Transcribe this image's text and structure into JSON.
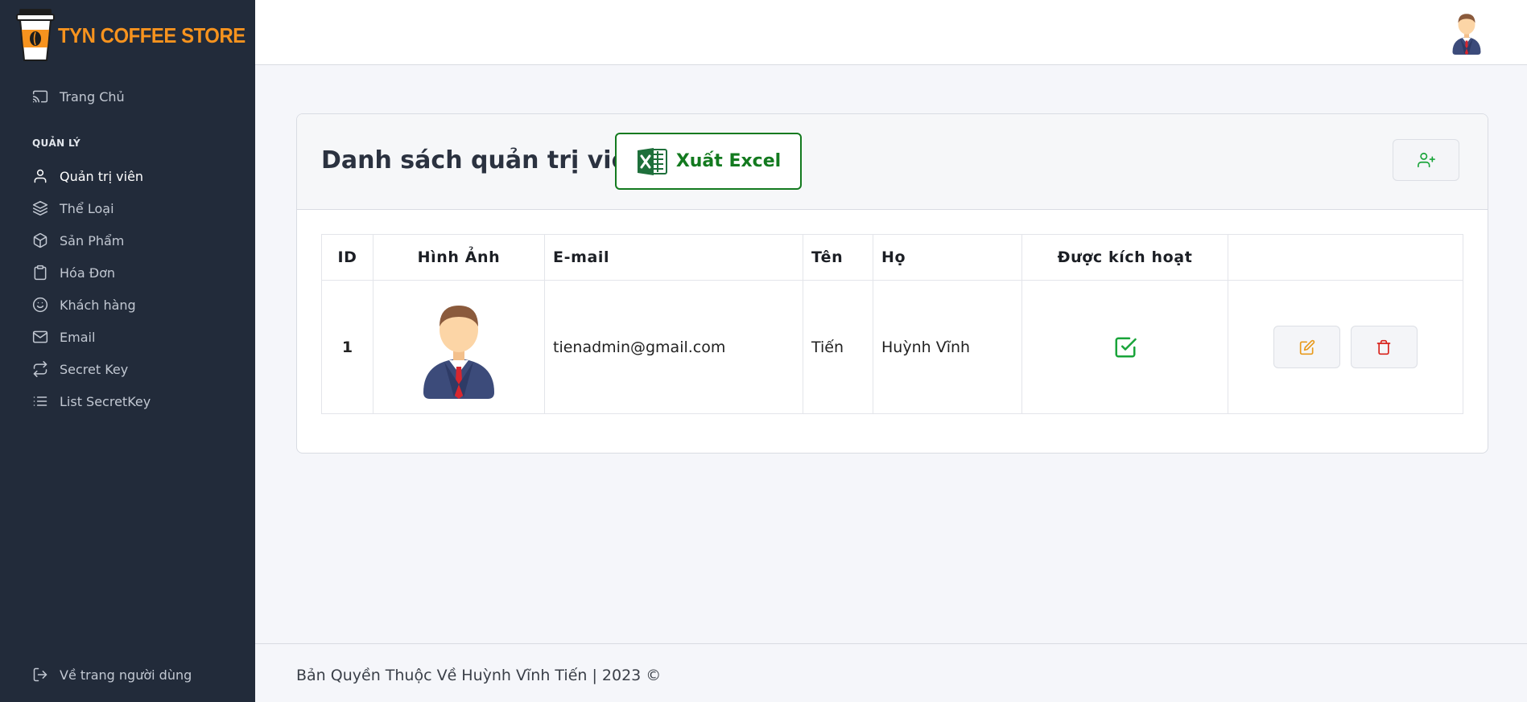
{
  "brand": {
    "name": "TYN COFFEE STORE",
    "color": "#f7931e"
  },
  "sidebar": {
    "home": {
      "label": "Trang Chủ",
      "icon": "cast-icon"
    },
    "section_label": "QUẢN LÝ",
    "items": [
      {
        "label": "Quản trị viên",
        "icon": "user-icon",
        "active": true
      },
      {
        "label": "Thể Loại",
        "icon": "layers-icon",
        "active": false
      },
      {
        "label": "Sản Phẩm",
        "icon": "box-icon",
        "active": false
      },
      {
        "label": "Hóa Đơn",
        "icon": "clipboard-icon",
        "active": false
      },
      {
        "label": "Khách hàng",
        "icon": "smile-icon",
        "active": false
      },
      {
        "label": "Email",
        "icon": "mail-icon",
        "active": false
      },
      {
        "label": "Secret Key",
        "icon": "repeat-icon",
        "active": false
      },
      {
        "label": "List SecretKey",
        "icon": "list-icon",
        "active": false
      }
    ],
    "back_to_user": {
      "label": "Về trang người dùng",
      "icon": "log-out-icon"
    }
  },
  "page": {
    "title": "Danh sách quản trị viên",
    "export_label": "Xuất Excel",
    "export_color": "#137a1f",
    "add_icon": "user-plus-icon"
  },
  "table": {
    "headers": {
      "id": "ID",
      "image": "Hình Ảnh",
      "email": "E-mail",
      "first_name": "Tên",
      "last_name": "Họ",
      "enabled": "Được kích hoạt"
    },
    "rows": [
      {
        "id": "1",
        "email": "tienadmin@gmail.com",
        "first_name": "Tiến",
        "last_name": "Huỳnh Vĩnh",
        "enabled": true
      }
    ]
  },
  "footer": {
    "text": "Bản Quyền Thuộc Về Huỳnh Vĩnh Tiến | 2023 ©"
  }
}
